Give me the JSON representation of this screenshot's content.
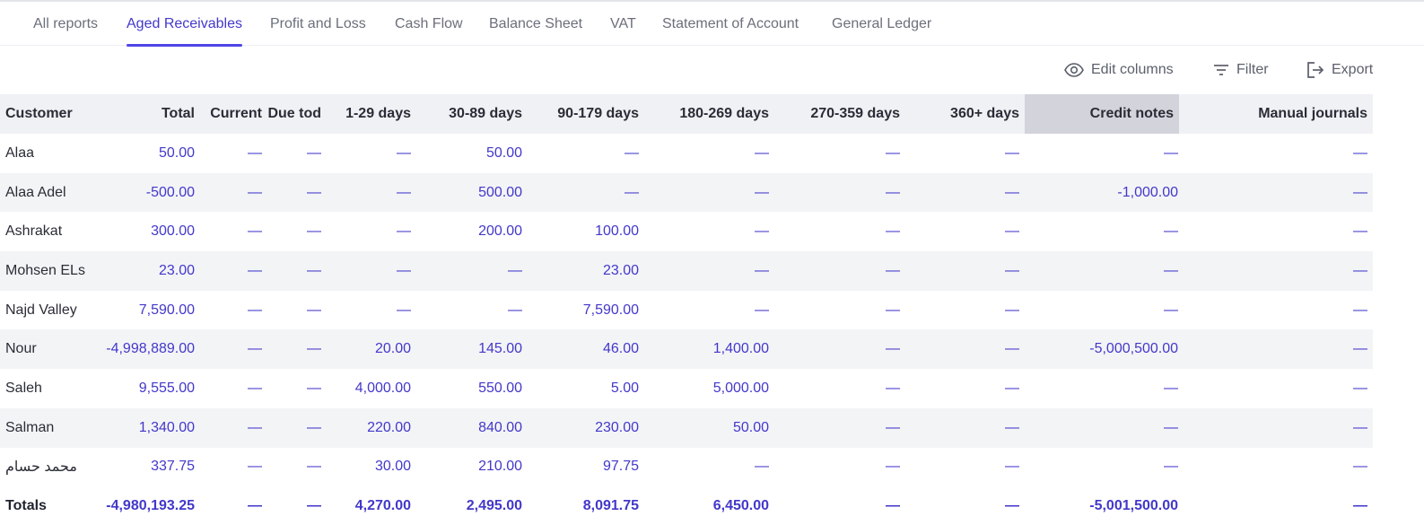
{
  "tabs": [
    {
      "label": "All reports"
    },
    {
      "label": "Aged Receivables",
      "active": true
    },
    {
      "label": "Profit and Loss"
    },
    {
      "label": "Cash Flow"
    },
    {
      "label": "Balance Sheet"
    },
    {
      "label": "VAT"
    },
    {
      "label": "Statement of Account"
    },
    {
      "label": "General Ledger"
    }
  ],
  "toolbar": {
    "edit_columns": {
      "label": "Edit columns",
      "icon": "eye-icon"
    },
    "filter": {
      "label": "Filter",
      "icon": "filter-icon"
    },
    "export": {
      "label": "Export",
      "icon": "export-icon"
    }
  },
  "colors": {
    "accent": "#4f46e5",
    "value_text": "#4338ca",
    "header_bg": "#f0f1f5",
    "highlight_col": "#d3d4db"
  },
  "table": {
    "columns": [
      "Customer",
      "Total",
      "Current",
      "Due tod",
      "1-29 days",
      "30-89 days",
      "90-179 days",
      "180-269 days",
      "270-359 days",
      "360+ days",
      "Credit notes",
      "Manual journals"
    ],
    "rows": [
      [
        "Alaa",
        "50.00",
        "—",
        "—",
        "—",
        "50.00",
        "—",
        "—",
        "—",
        "—",
        "—",
        "—"
      ],
      [
        "Alaa Adel",
        "-500.00",
        "—",
        "—",
        "—",
        "500.00",
        "—",
        "—",
        "—",
        "—",
        "-1,000.00",
        "—"
      ],
      [
        "Ashrakat",
        "300.00",
        "—",
        "—",
        "—",
        "200.00",
        "100.00",
        "—",
        "—",
        "—",
        "—",
        "—"
      ],
      [
        "Mohsen ELs",
        "23.00",
        "—",
        "—",
        "—",
        "—",
        "23.00",
        "—",
        "—",
        "—",
        "—",
        "—"
      ],
      [
        "Najd Valley",
        "7,590.00",
        "—",
        "—",
        "—",
        "—",
        "7,590.00",
        "—",
        "—",
        "—",
        "—",
        "—"
      ],
      [
        "Nour",
        "-4,998,889.00",
        "—",
        "—",
        "20.00",
        "145.00",
        "46.00",
        "1,400.00",
        "—",
        "—",
        "-5,000,500.00",
        "—"
      ],
      [
        "Saleh",
        "9,555.00",
        "—",
        "—",
        "4,000.00",
        "550.00",
        "5.00",
        "5,000.00",
        "—",
        "—",
        "—",
        "—"
      ],
      [
        "Salman",
        "1,340.00",
        "—",
        "—",
        "220.00",
        "840.00",
        "230.00",
        "50.00",
        "—",
        "—",
        "—",
        "—"
      ],
      [
        "محمد حسام",
        "337.75",
        "—",
        "—",
        "30.00",
        "210.00",
        "97.75",
        "—",
        "—",
        "—",
        "—",
        "—"
      ]
    ],
    "totals": [
      "Totals",
      "-4,980,193.25",
      "—",
      "—",
      "4,270.00",
      "2,495.00",
      "8,091.75",
      "6,450.00",
      "—",
      "—",
      "-5,001,500.00",
      "—"
    ]
  }
}
